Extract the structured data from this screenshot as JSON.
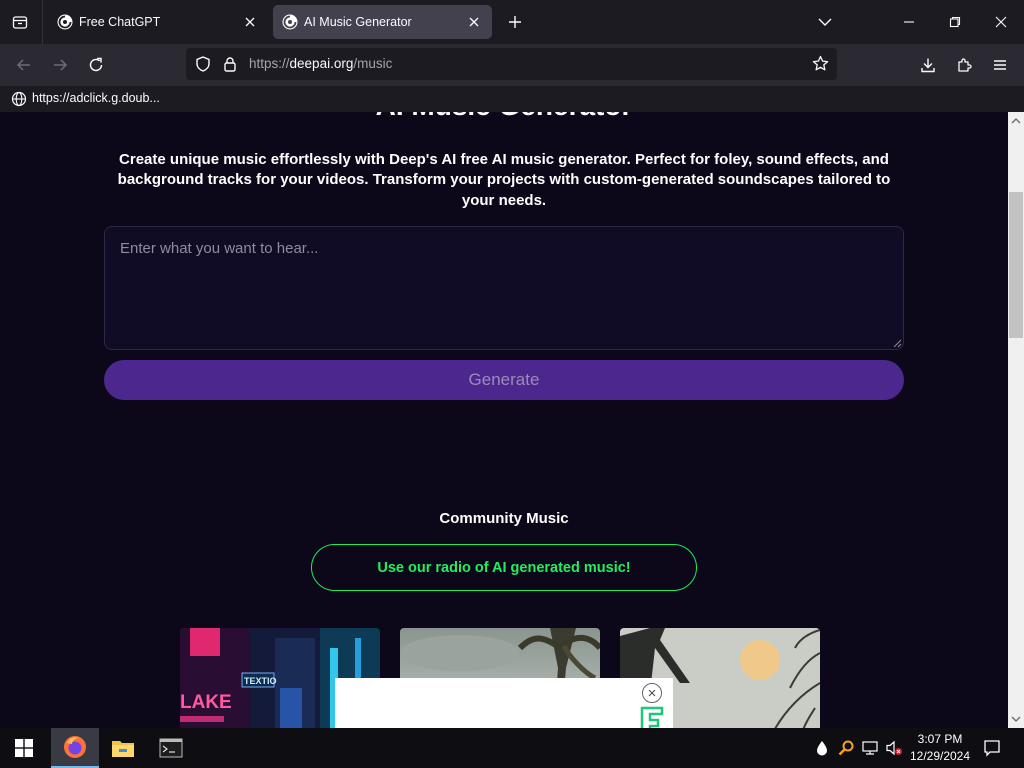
{
  "browser": {
    "tabs": [
      {
        "title": "Free ChatGPT",
        "active": false
      },
      {
        "title": "AI Music Generator",
        "active": true
      }
    ],
    "url": {
      "scheme": "https://",
      "host": "deepai.org",
      "path": "/music"
    },
    "link_status": "https://adclick.g.doub..."
  },
  "page": {
    "heading": "AI Music Generator",
    "description": "Create unique music effortlessly with Deep's AI free AI music generator. Perfect for foley, sound effects, and background tracks for your videos. Transform your projects with custom-generated soundscapes tailored to your needs.",
    "prompt": {
      "placeholder": "Enter what you want to hear...",
      "value": ""
    },
    "generate_label": "Generate",
    "community_title": "Community Music",
    "radio_label": "Use our radio of AI generated music!",
    "thumbnails": [
      {
        "name": "neon-city",
        "sign_text": "LAKE",
        "sign2_text": "TEXTIO"
      },
      {
        "name": "palm-sky"
      },
      {
        "name": "moon-tree"
      }
    ]
  },
  "taskbar": {
    "apps": [
      "start",
      "firefox",
      "file-explorer",
      "terminal"
    ],
    "time": "3:07 PM",
    "date": "12/29/2024"
  },
  "colors": {
    "page_bg": "#0c0819",
    "accent_purple": "#4b278e",
    "radio_green": "#22ee60"
  }
}
